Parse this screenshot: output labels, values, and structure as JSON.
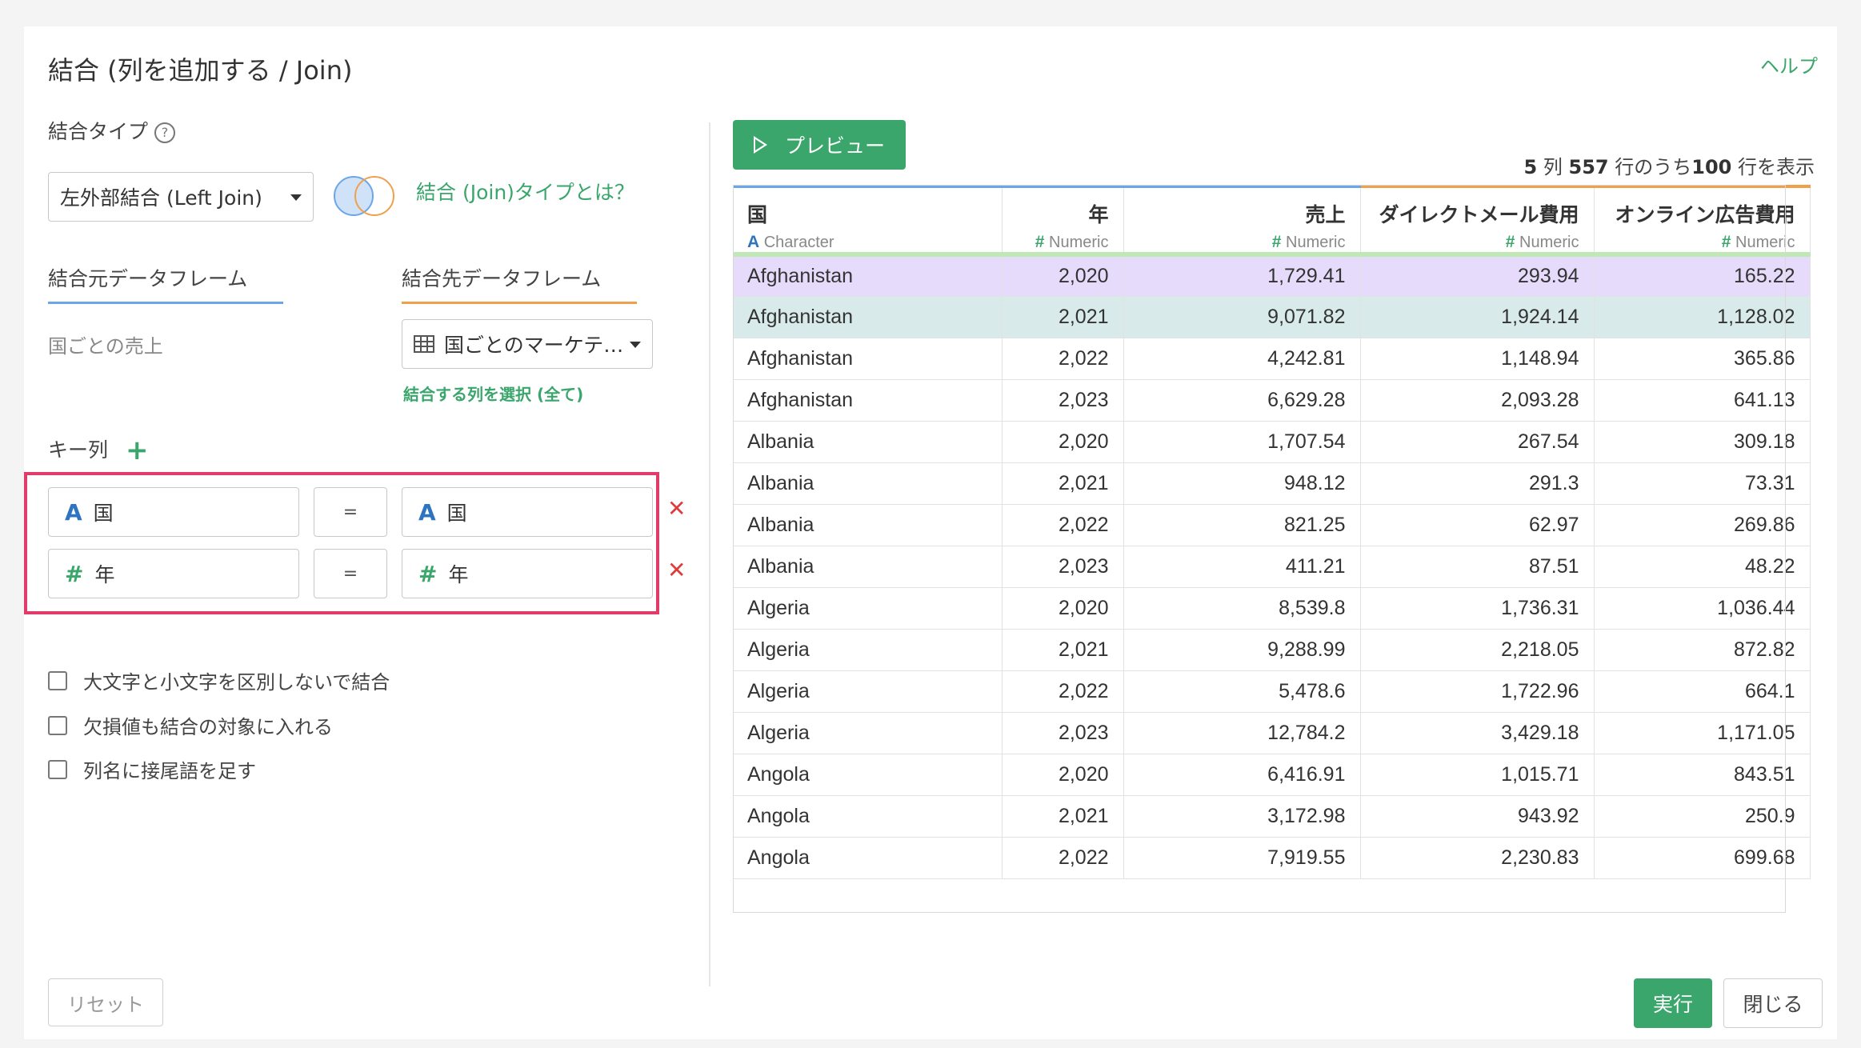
{
  "dialog": {
    "title": "結合 (列を追加する / Join)",
    "help_link": "ヘルプ"
  },
  "join_type": {
    "label": "結合タイプ",
    "help_icon": "question-circle-icon",
    "selected": "左外部結合 (Left Join)",
    "venn_icon": "venn-diagram-icon",
    "info_link": "結合 (Join)タイプとは？"
  },
  "source": {
    "tab_label": "結合元データフレーム",
    "value": "国ごとの売上"
  },
  "target": {
    "tab_label": "結合先データフレーム",
    "table_icon": "table-grid-icon",
    "selected": "国ごとのマーケテ…",
    "select_columns_link": "結合する列を選択 (全て)"
  },
  "keys": {
    "label": "キー列",
    "add_icon": "plus-icon",
    "rows": [
      {
        "left_type": "A",
        "left": "国",
        "op": "=",
        "right_type": "A",
        "right": "国",
        "delete": "✕"
      },
      {
        "left_type": "#",
        "left": "年",
        "op": "=",
        "right_type": "#",
        "right": "年",
        "delete": "✕"
      }
    ]
  },
  "options": [
    {
      "label": "大文字と小文字を区別しないで結合",
      "checked": false
    },
    {
      "label": "欠損値も結合の対象に入れる",
      "checked": false
    },
    {
      "label": "列名に接尾語を足す",
      "checked": false
    }
  ],
  "preview": {
    "button_label": "プレビュー",
    "summary": {
      "cols": "5",
      "cols_unit": "列",
      "total": "557",
      "mid": "行のうち",
      "shown": "100",
      "tail": "行を表示"
    },
    "columns": [
      {
        "name": "国",
        "type_icon": "A",
        "type": "Character",
        "accent": "#6aa6e8"
      },
      {
        "name": "年",
        "type_icon": "#",
        "type": "Numeric",
        "accent": "#6aa6e8"
      },
      {
        "name": "売上",
        "type_icon": "#",
        "type": "Numeric",
        "accent": "#6aa6e8"
      },
      {
        "name": "ダイレクトメール費用",
        "type_icon": "#",
        "type": "Numeric",
        "accent": "#f0a04b"
      },
      {
        "name": "オンライン広告費用",
        "type_icon": "#",
        "type": "Numeric",
        "accent": "#f0a04b"
      }
    ],
    "rows": [
      [
        "Afghanistan",
        "2,020",
        "1,729.41",
        "293.94",
        "165.22"
      ],
      [
        "Afghanistan",
        "2,021",
        "9,071.82",
        "1,924.14",
        "1,128.02"
      ],
      [
        "Afghanistan",
        "2,022",
        "4,242.81",
        "1,148.94",
        "365.86"
      ],
      [
        "Afghanistan",
        "2,023",
        "6,629.28",
        "2,093.28",
        "641.13"
      ],
      [
        "Albania",
        "2,020",
        "1,707.54",
        "267.54",
        "309.18"
      ],
      [
        "Albania",
        "2,021",
        "948.12",
        "291.3",
        "73.31"
      ],
      [
        "Albania",
        "2,022",
        "821.25",
        "62.97",
        "269.86"
      ],
      [
        "Albania",
        "2,023",
        "411.21",
        "87.51",
        "48.22"
      ],
      [
        "Algeria",
        "2,020",
        "8,539.8",
        "1,736.31",
        "1,036.44"
      ],
      [
        "Algeria",
        "2,021",
        "9,288.99",
        "2,218.05",
        "872.82"
      ],
      [
        "Algeria",
        "2,022",
        "5,478.6",
        "1,722.96",
        "664.1"
      ],
      [
        "Algeria",
        "2,023",
        "12,784.2",
        "3,429.18",
        "1,171.05"
      ],
      [
        "Angola",
        "2,020",
        "6,416.91",
        "1,015.71",
        "843.51"
      ],
      [
        "Angola",
        "2,021",
        "3,172.98",
        "943.92",
        "250.9"
      ],
      [
        "Angola",
        "2,022",
        "7,919.55",
        "2,230.83",
        "699.68"
      ]
    ],
    "row_colors": {
      "0": "#e6dbfb",
      "1": "#d8eaea"
    },
    "header_bottom_color": "#bfe8b4"
  },
  "footer": {
    "reset": "リセット",
    "run": "実行",
    "close": "閉じる"
  },
  "highlight_color": "#e23b6a"
}
